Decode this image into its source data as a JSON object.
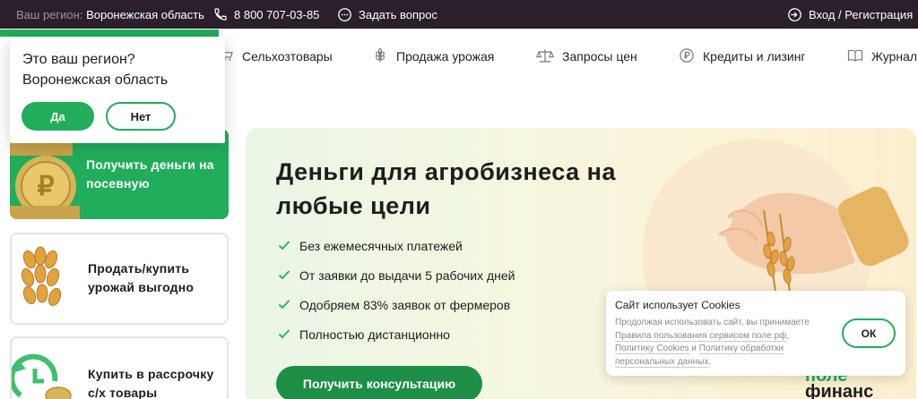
{
  "topbar": {
    "region_label": "Ваш регион:",
    "region_value": "Воронежская область",
    "phone": "8 800 707-03-85",
    "ask": "Задать вопрос",
    "login": "Вход / Регистрация"
  },
  "nav": {
    "items": [
      {
        "label": "Сельхозтовары",
        "icon": "cart-icon"
      },
      {
        "label": "Продажа урожая",
        "icon": "wheat-icon"
      },
      {
        "label": "Запросы цен",
        "icon": "scales-icon"
      },
      {
        "label": "Кредиты и лизинг",
        "icon": "ruble-icon"
      },
      {
        "label": "Журнал",
        "icon": "book-icon"
      }
    ]
  },
  "region_popup": {
    "line1": "Это ваш регион?",
    "line2": "Воронежская область",
    "yes": "Да",
    "no": "Нет"
  },
  "cards": [
    {
      "line1": "Получить деньги на",
      "line2": "посевную"
    },
    {
      "line1": "Продать/купить",
      "line2": "урожай выгодно"
    },
    {
      "line1": "Купить в рассрочку",
      "line2": "с/х товары"
    }
  ],
  "hero": {
    "title_line1": "Деньги для агробизнеса на",
    "title_line2": "любые цели",
    "benefits": [
      "Без ежемесячных платежей",
      "От заявки до выдачи 5 рабочих дней",
      "Одобряем 83% заявок от фермеров",
      "Полностью дистанционно"
    ],
    "cta": "Получить консультацию",
    "brand_line1": "поле",
    "brand_line2": "финанс"
  },
  "cookie": {
    "title": "Сайт использует Cookies",
    "text_prefix": "Продолжая использовать сайт, вы принимаете ",
    "link1": "Правила пользования сервисом поле.рф",
    "sep1": ", ",
    "link2": "Политику Cookies",
    "sep2": " и ",
    "link3": "Политику обработки персональных данных",
    "suffix": ".",
    "ok": "ОК"
  },
  "colors": {
    "topbar_bg": "#2b1f2c",
    "brand_green": "#21ad5b",
    "cta_green": "#1e8f47"
  }
}
